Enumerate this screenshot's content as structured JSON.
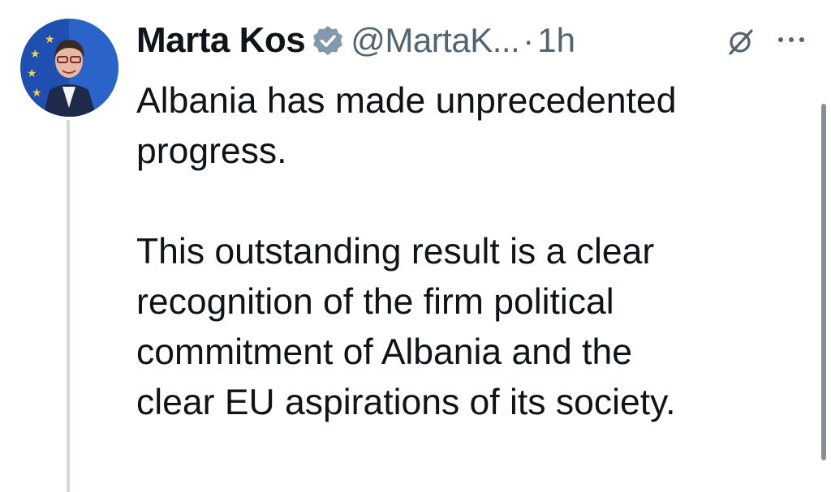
{
  "author": {
    "name": "Marta Kos",
    "handle": "@MartaK...",
    "separator": "·",
    "time": "1h",
    "verified": true
  },
  "icons": {
    "verified": "verified-badge-icon",
    "grok": "grok-icon",
    "more": "more-options-icon"
  },
  "tweet": {
    "paragraphs": [
      "Albania has made unprecedented\nprogress.",
      "This outstanding result is a clear\nrecognition of the firm political\ncommitment of Albania and the\nclear EU aspirations of its society."
    ]
  },
  "colors": {
    "text": "#0f1419",
    "secondary": "#536471",
    "verified_badge": "#829aab",
    "thread_line": "#cfd9de"
  }
}
